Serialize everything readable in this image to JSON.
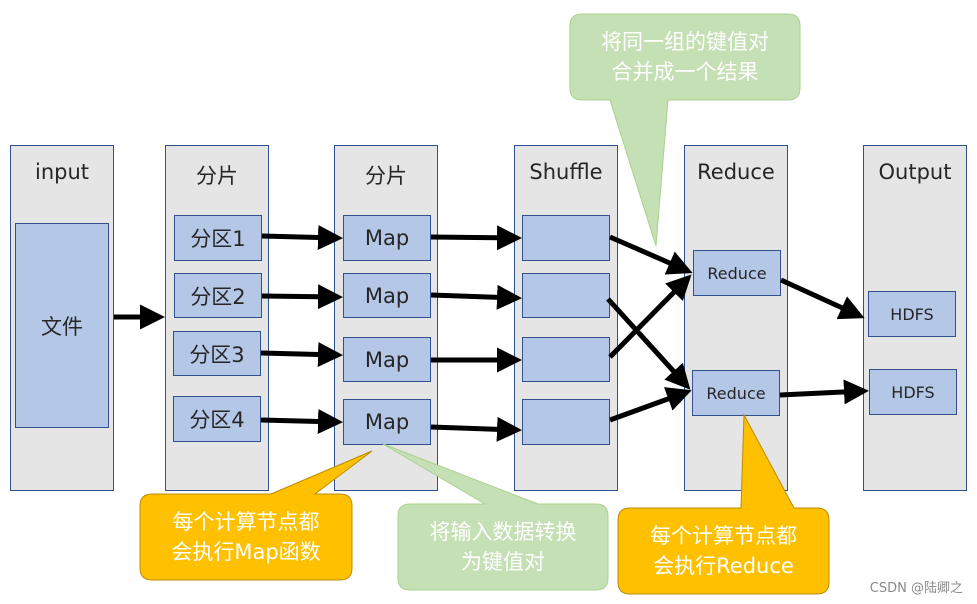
{
  "columns": [
    {
      "id": "input",
      "title": "input"
    },
    {
      "id": "split",
      "title": "分片"
    },
    {
      "id": "map",
      "title": "分片"
    },
    {
      "id": "shuffle",
      "title": "Shuffle"
    },
    {
      "id": "reduce",
      "title": "Reduce"
    },
    {
      "id": "output",
      "title": "Output"
    }
  ],
  "input_node": "文件",
  "partitions": [
    "分区1",
    "分区2",
    "分区3",
    "分区4"
  ],
  "maps": [
    "Map",
    "Map",
    "Map",
    "Map"
  ],
  "shuffle_slots": [
    "",
    "",
    "",
    ""
  ],
  "reducers": [
    "Reduce",
    "Reduce"
  ],
  "outputs": [
    "HDFS",
    "HDFS"
  ],
  "callouts": {
    "shuffle_merge": [
      "将同一组的键值对",
      "合并成一个结果"
    ],
    "map_exec": [
      "每个计算节点都",
      "会执行Map函数"
    ],
    "map_kv": [
      "将输入数据转换",
      "为键值对"
    ],
    "reduce_exec": [
      "每个计算节点都",
      "会执行Reduce"
    ]
  },
  "colors": {
    "column_fill": "#e5e5e5",
    "column_border": "#2f528f",
    "node_fill": "#b4c7e7",
    "callout_green": "#c5e0b4",
    "callout_orange": "#ffc000",
    "arrow": "#000000"
  },
  "watermark": "CSDN @陆卿之"
}
